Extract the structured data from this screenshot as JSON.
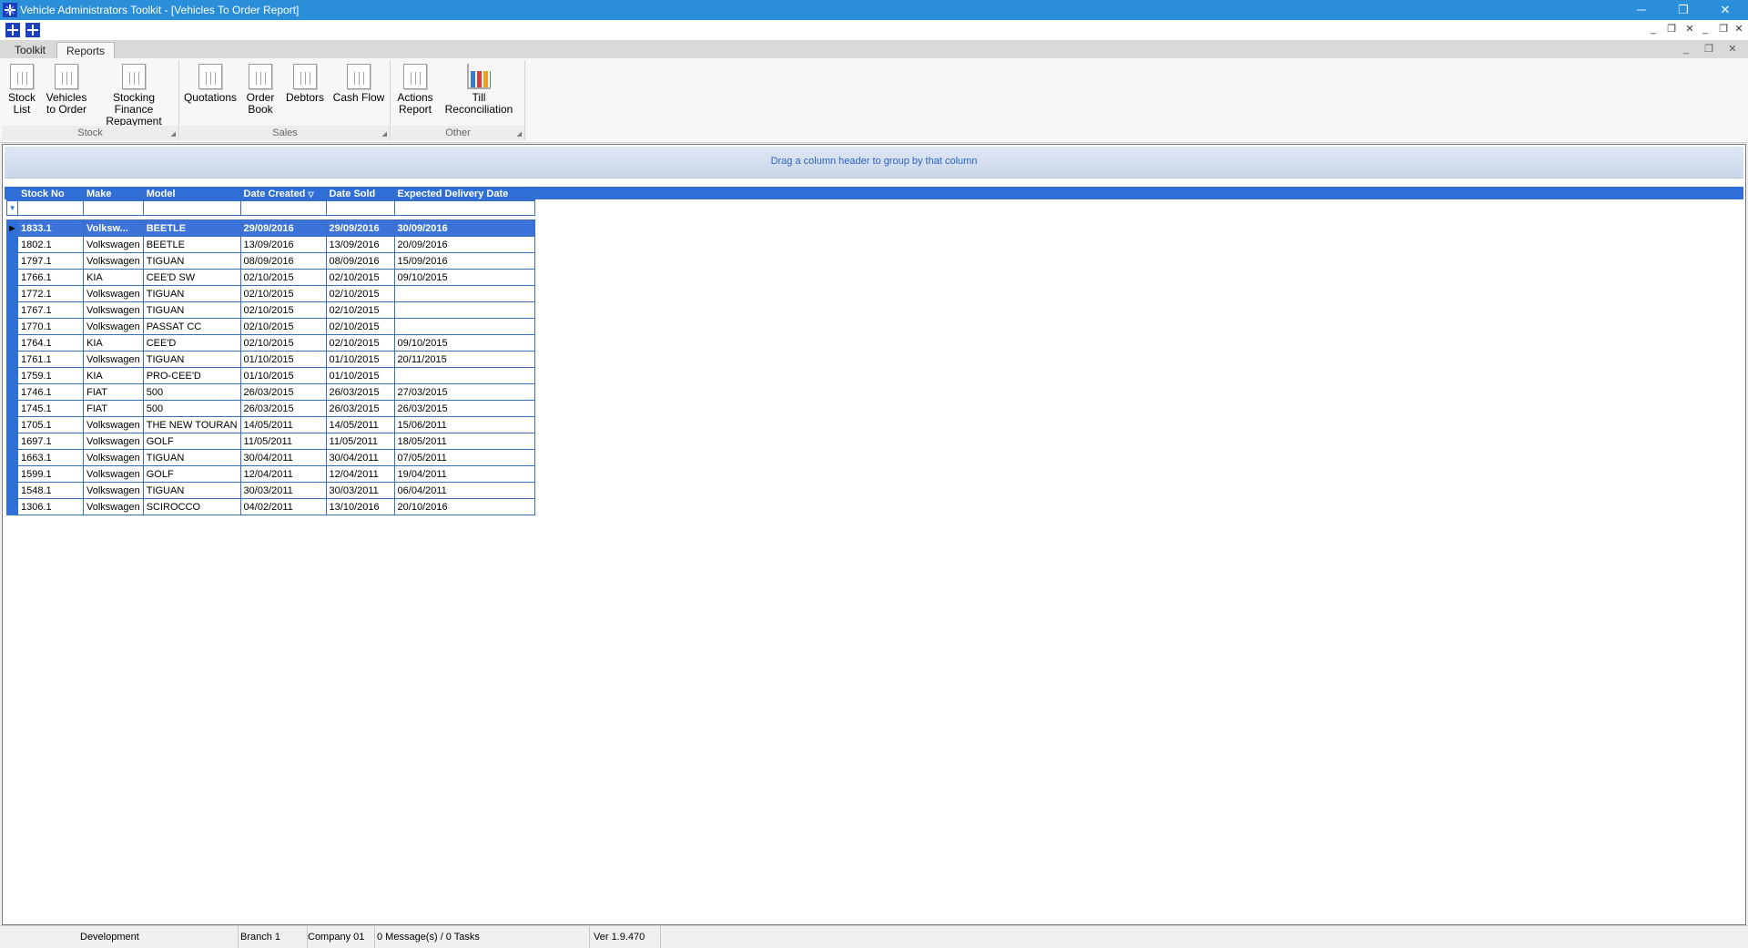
{
  "window": {
    "title": "Vehicle Administrators Toolkit - [Vehicles To Order Report]",
    "minimize": "─",
    "restore": "❐",
    "close": "✕"
  },
  "mdi": {
    "minimize": "_",
    "restore": "❐",
    "close": "✕"
  },
  "ribbon": {
    "tabs": [
      {
        "label": "Toolkit"
      },
      {
        "label": "Reports"
      }
    ],
    "groups": [
      {
        "label": "Stock",
        "buttons": [
          {
            "label_line1": "Stock",
            "label_line2": "List",
            "icon": "report-icon"
          },
          {
            "label_line1": "Vehicles",
            "label_line2": "to Order",
            "icon": "report-icon"
          },
          {
            "label_line1": "Stocking Finance",
            "label_line2": "Repayment",
            "icon": "report-icon"
          }
        ]
      },
      {
        "label": "Sales",
        "buttons": [
          {
            "label_line1": "Quotations",
            "label_line2": "",
            "icon": "report-icon"
          },
          {
            "label_line1": "Order",
            "label_line2": "Book",
            "icon": "report-icon"
          },
          {
            "label_line1": "Debtors",
            "label_line2": "",
            "icon": "report-icon"
          },
          {
            "label_line1": "Cash Flow",
            "label_line2": "",
            "icon": "report-icon"
          }
        ]
      },
      {
        "label": "Other",
        "buttons": [
          {
            "label_line1": "Actions",
            "label_line2": "Report",
            "icon": "report-icon"
          },
          {
            "label_line1": "Till Reconciliation",
            "label_line2": "",
            "icon": "chart-icon"
          }
        ]
      }
    ]
  },
  "grid": {
    "group_hint": "Drag a column header to group by that column",
    "columns": [
      "Stock No",
      "Make",
      "Model",
      "Date Created",
      "Date Sold",
      "Expected Delivery Date"
    ],
    "sort_indicator": "▽",
    "filter_icon": "▾",
    "row_pointer": "▶",
    "rows": [
      [
        "1833.1",
        "Volksw...",
        "BEETLE",
        "29/09/2016",
        "29/09/2016",
        "30/09/2016"
      ],
      [
        "1802.1",
        "Volkswagen",
        "BEETLE",
        "13/09/2016",
        "13/09/2016",
        "20/09/2016"
      ],
      [
        "1797.1",
        "Volkswagen",
        "TIGUAN",
        "08/09/2016",
        "08/09/2016",
        "15/09/2016"
      ],
      [
        "1766.1",
        "KIA",
        "CEE'D SW",
        "02/10/2015",
        "02/10/2015",
        "09/10/2015"
      ],
      [
        "1772.1",
        "Volkswagen",
        "TIGUAN",
        "02/10/2015",
        "02/10/2015",
        ""
      ],
      [
        "1767.1",
        "Volkswagen",
        "TIGUAN",
        "02/10/2015",
        "02/10/2015",
        ""
      ],
      [
        "1770.1",
        "Volkswagen",
        "PASSAT CC",
        "02/10/2015",
        "02/10/2015",
        ""
      ],
      [
        "1764.1",
        "KIA",
        "CEE'D",
        "02/10/2015",
        "02/10/2015",
        "09/10/2015"
      ],
      [
        "1761.1",
        "Volkswagen",
        "TIGUAN",
        "01/10/2015",
        "01/10/2015",
        "20/11/2015"
      ],
      [
        "1759.1",
        "KIA",
        "PRO-CEE'D",
        "01/10/2015",
        "01/10/2015",
        ""
      ],
      [
        "1746.1",
        "FIAT",
        "500",
        "26/03/2015",
        "26/03/2015",
        "27/03/2015"
      ],
      [
        "1745.1",
        "FIAT",
        "500",
        "26/03/2015",
        "26/03/2015",
        "26/03/2015"
      ],
      [
        "1705.1",
        "Volkswagen",
        "THE NEW TOURAN",
        "14/05/2011",
        "14/05/2011",
        "15/06/2011"
      ],
      [
        "1697.1",
        "Volkswagen",
        "GOLF",
        "11/05/2011",
        "11/05/2011",
        "18/05/2011"
      ],
      [
        "1663.1",
        "Volkswagen",
        "TIGUAN",
        "30/04/2011",
        "30/04/2011",
        "07/05/2011"
      ],
      [
        "1599.1",
        "Volkswagen",
        "GOLF",
        "12/04/2011",
        "12/04/2011",
        "19/04/2011"
      ],
      [
        "1548.1",
        "Volkswagen",
        "TIGUAN",
        "30/03/2011",
        "30/03/2011",
        "06/04/2011"
      ],
      [
        "1306.1",
        "Volkswagen",
        "SCIROCCO",
        "04/02/2011",
        "13/10/2016",
        "20/10/2016"
      ]
    ]
  },
  "status": {
    "environment": "Development",
    "branch": "Branch 1",
    "company": "Company 01",
    "messages": "0 Message(s) / 0 Tasks",
    "version": "Ver 1.9.470"
  },
  "colors": {
    "titlebar": "#2b8ed8",
    "grid_header": "#2f6fd6",
    "selected_row": "#3b73d8",
    "group_hint_text": "#2a64c4"
  }
}
